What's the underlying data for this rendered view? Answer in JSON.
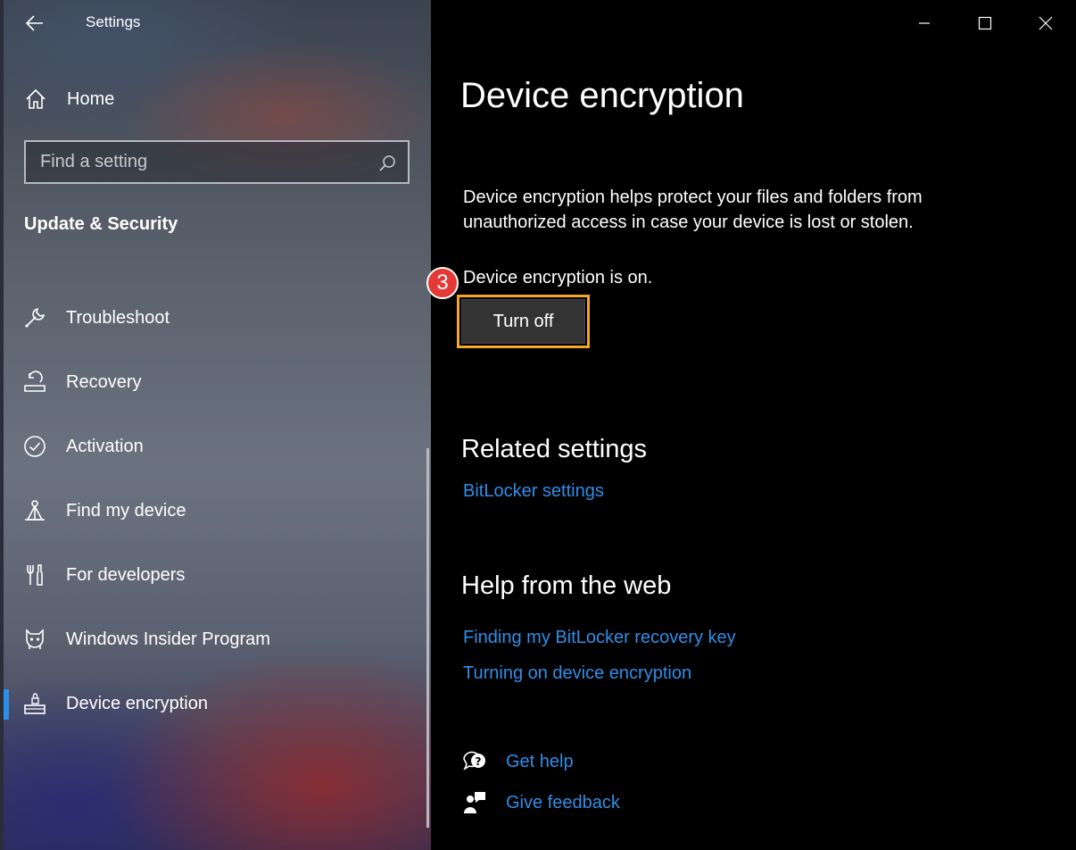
{
  "window": {
    "title": "Settings"
  },
  "sidebar": {
    "home_label": "Home",
    "search_placeholder": "Find a setting",
    "section_title": "Update & Security",
    "items": [
      {
        "label": "Troubleshoot",
        "icon": "wrench-icon"
      },
      {
        "label": "Recovery",
        "icon": "recovery-icon"
      },
      {
        "label": "Activation",
        "icon": "check-circle-icon"
      },
      {
        "label": "Find my device",
        "icon": "find-device-icon"
      },
      {
        "label": "For developers",
        "icon": "developer-tools-icon"
      },
      {
        "label": "Windows Insider Program",
        "icon": "insider-icon"
      },
      {
        "label": "Device encryption",
        "icon": "drive-lock-icon",
        "selected": true
      }
    ],
    "accent": "#2f8ee8"
  },
  "main": {
    "title": "Device encryption",
    "description": "Device encryption helps protect your files and folders from unauthorized access in case your device is lost or stolen.",
    "status": "Device encryption is on.",
    "turn_off_label": "Turn off",
    "step_number": "3",
    "related_title": "Related settings",
    "related_links": [
      "BitLocker settings"
    ],
    "web_title": "Help from the web",
    "web_links": [
      "Finding my BitLocker recovery key",
      "Turning on device encryption"
    ],
    "get_help_label": "Get help",
    "feedback_label": "Give feedback",
    "link_color": "#2f8ee8",
    "highlight_color": "#f5a623",
    "badge_color": "#e53935"
  }
}
